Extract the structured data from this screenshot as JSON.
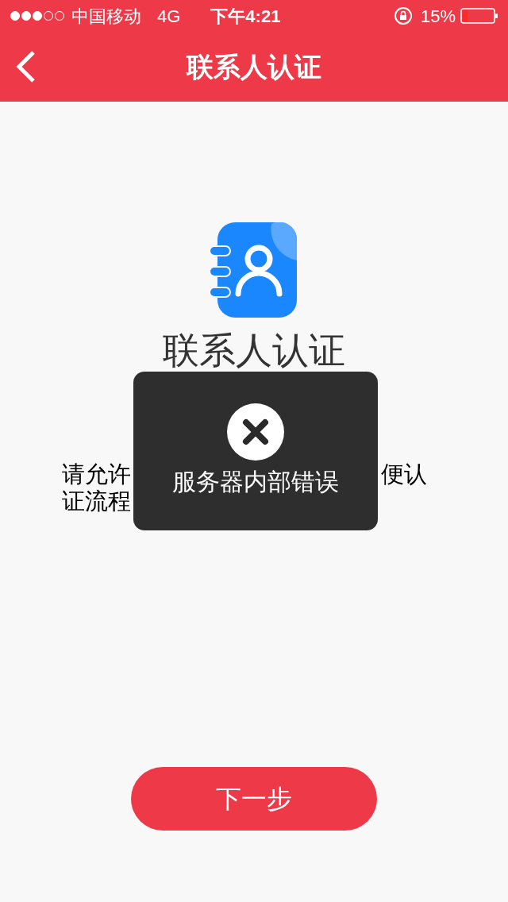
{
  "status_bar": {
    "carrier": "中国移动",
    "network": "4G",
    "time": "下午4:21",
    "battery": "15%"
  },
  "nav": {
    "title": "联系人认证"
  },
  "content": {
    "heading": "联系人认证",
    "message_line_1_left": "请允许",
    "message_line_1_right": "便认",
    "message_line_2_left": "证流程"
  },
  "toast": {
    "message": "服务器内部错误"
  },
  "next_button": {
    "label": "下一步"
  }
}
